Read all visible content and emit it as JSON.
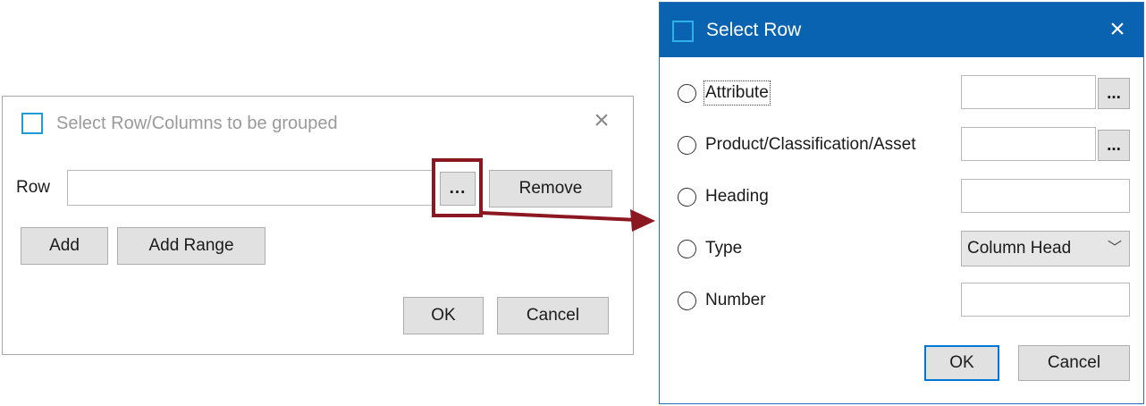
{
  "group_dialog": {
    "title": "Select Row/Columns to be grouped",
    "row_label": "Row",
    "row_value": "",
    "browse_label": "...",
    "remove_label": "Remove",
    "add_label": "Add",
    "add_range_label": "Add Range",
    "ok_label": "OK",
    "cancel_label": "Cancel"
  },
  "select_row_dialog": {
    "title": "Select Row",
    "options": [
      {
        "label": "Attribute",
        "value": ""
      },
      {
        "label": "Product/Classification/Asset",
        "value": ""
      },
      {
        "label": "Heading",
        "value": ""
      },
      {
        "label": "Type",
        "value": "Column Head"
      },
      {
        "label": "Number",
        "value": ""
      }
    ],
    "browse_label": "...",
    "ok_label": "OK",
    "cancel_label": "Cancel"
  },
  "colors": {
    "titlebar": "#0a63b0",
    "highlight": "#8b1820",
    "accent": "#1e9ad6"
  },
  "icons": {
    "close": "close-icon",
    "window": "window-icon",
    "chevron": "chevron-down-icon"
  }
}
